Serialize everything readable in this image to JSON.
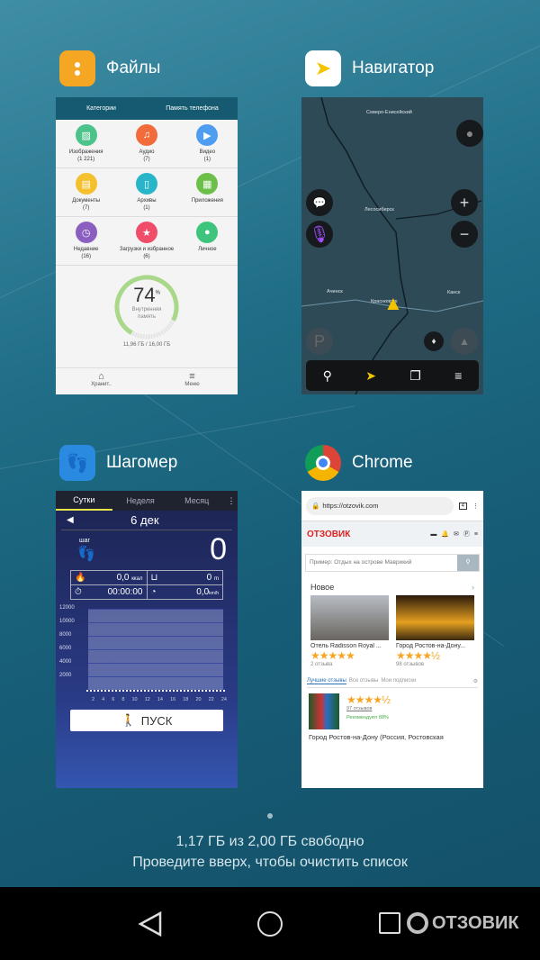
{
  "apps": [
    {
      "name": "Файлы",
      "icon": "files-folder-icon",
      "color": "#f5a623"
    },
    {
      "name": "Навигатор",
      "icon": "navigator-arrow-icon",
      "color": "#ffffff"
    },
    {
      "name": "Шагомер",
      "icon": "footprints-icon",
      "color": "#2a8ae0"
    },
    {
      "name": "Chrome",
      "icon": "chrome-icon",
      "color": "#ffffff"
    }
  ],
  "files": {
    "tabs": [
      "Категории",
      "Память телефона"
    ],
    "categories": [
      {
        "label": "Изображения",
        "count": "(1 221)",
        "color": "#4cc38a",
        "icon": "image-icon"
      },
      {
        "label": "Аудио",
        "count": "(7)",
        "color": "#f26b3a",
        "icon": "music-icon"
      },
      {
        "label": "Видео",
        "count": "(1)",
        "color": "#4f9df0",
        "icon": "play-icon"
      },
      {
        "label": "Документы",
        "count": "(7)",
        "color": "#f5c02e",
        "icon": "document-icon"
      },
      {
        "label": "Архивы",
        "count": "(1)",
        "color": "#29b5c9",
        "icon": "archive-icon"
      },
      {
        "label": "Приложения",
        "count": "",
        "color": "#6cc04a",
        "icon": "apps-icon"
      },
      {
        "label": "Недавние",
        "count": "(16)",
        "color": "#8a5fc0",
        "icon": "clock-icon"
      },
      {
        "label": "Загрузки и избранное",
        "count": "(6)",
        "color": "#ef4d6a",
        "icon": "star-icon"
      },
      {
        "label": "Личное",
        "count": "",
        "color": "#3ec47d",
        "icon": "lock-icon"
      }
    ],
    "storage_percent": "74",
    "percent_sign": "%",
    "storage_label": "Внутренняя память",
    "storage_usage": "11,96 ГБ / 16,00 ГБ",
    "bottom": [
      "Хранит..",
      "Меню"
    ]
  },
  "navigator": {
    "labels": [
      "Северо-Енисейский",
      "Лесосибирск",
      "Ачинск",
      "Красноярск",
      "Канск"
    ]
  },
  "pedometer": {
    "tabs": [
      "Сутки",
      "Неделя",
      "Месяц"
    ],
    "date": "6 дек",
    "steps_label": "шаг",
    "steps": "0",
    "kcal": "0,0",
    "kcal_unit": "ккал",
    "distance": "0",
    "distance_unit": "m",
    "time": "00:00:00",
    "speed": "0,0",
    "speed_unit": "km/h",
    "y_ticks": [
      "12000",
      "10000",
      "8000",
      "6000",
      "4000",
      "2000"
    ],
    "x_ticks": [
      "2",
      "4",
      "6",
      "8",
      "10",
      "12",
      "14",
      "16",
      "18",
      "20",
      "22",
      "24"
    ],
    "start_label": "ПУСК"
  },
  "chrome": {
    "url": "https://otzovik.com",
    "tab_count": "4",
    "brand": "ОТЗОВИК",
    "search_placeholder": "Пример: Отдых на острове Маврикий",
    "section_title": "Новое",
    "items": [
      {
        "title": "Отель Radisson Royal ...",
        "stars": "★★★★★",
        "reviews": "2 отзыва"
      },
      {
        "title": "Город Ростов-на-Дону...",
        "stars": "★★★★½",
        "reviews": "98 отзывов"
      }
    ],
    "review_tabs": [
      "Лучшие отзывы",
      "Все отзывы",
      "Мои подписки"
    ],
    "featured": {
      "stars": "★★★★½",
      "reviews": "97 отзывов",
      "recommend": "Рекомендуют 88%",
      "title": "Город Ростов-на-Дону (Россия, Ростовская"
    }
  },
  "footer": {
    "memory": "1,17 ГБ из 2,00 ГБ свободно",
    "hint": "Проведите вверх, чтобы очистить список"
  },
  "watermark": "ОТЗОВИК"
}
